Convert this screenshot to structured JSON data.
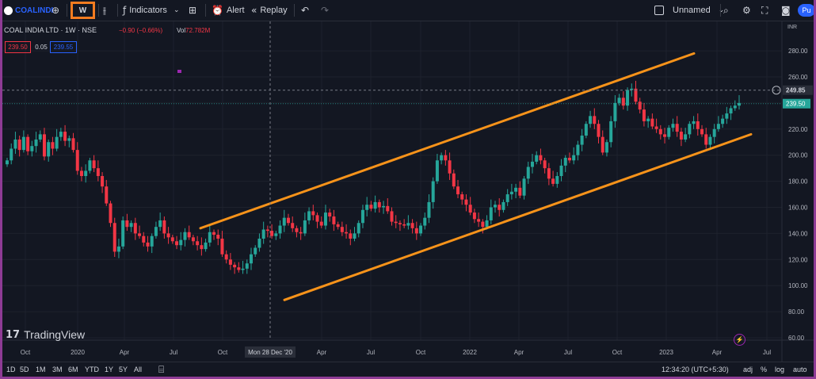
{
  "toolbar": {
    "symbol": "COALINDI",
    "interval": "W",
    "indicators_label": "Indicators",
    "alert_label": "Alert",
    "replay_label": "Replay",
    "layout_name": "Unnamed",
    "user_initials": "Pu",
    "icons": [
      "symbol-logo",
      "add-symbol",
      "bar-style",
      "indicators",
      "templates",
      "alert",
      "replay",
      "undo",
      "redo",
      "layout-checkbox",
      "search",
      "settings",
      "fullscreen",
      "snapshot"
    ]
  },
  "legend": {
    "title": "COAL INDIA LTD · 1W · NSE",
    "change": "−0.90 (−0.66%)",
    "vol_label": "Vol",
    "vol_value": "72.782M",
    "bid": "239.50",
    "spread": "0.05",
    "ask": "239.55"
  },
  "price_axis": {
    "currency": "INR",
    "ticks": [
      "280.00",
      "260.00",
      "240.00",
      "220.00",
      "200.00",
      "180.00",
      "160.00",
      "140.00",
      "120.00",
      "100.00",
      "80.00",
      "60.00"
    ],
    "crosshair_price": "249.85",
    "last_price": "239.50"
  },
  "time_axis": {
    "ticks": [
      "Oct",
      "2020",
      "Apr",
      "Jul",
      "Oct",
      "Apr",
      "Jul",
      "Oct",
      "2022",
      "Apr",
      "Jul",
      "Oct",
      "2023",
      "Apr",
      "Jul"
    ],
    "crosshair_date": "Mon 28 Dec '20"
  },
  "branding": "TradingView",
  "colors": {
    "up": "#26a69a",
    "down": "#f23645",
    "channel": "#f7931a",
    "background": "#131722",
    "frame": "#8e3b95",
    "highlight": "#f47c20"
  },
  "bottom": {
    "ranges": [
      "1D",
      "5D",
      "1M",
      "3M",
      "6M",
      "YTD",
      "1Y",
      "5Y",
      "All"
    ],
    "time": "12:34:20 (UTC+5:30)",
    "adj": "adj",
    "percent": "%",
    "log": "log",
    "auto": "auto"
  },
  "chart_data": {
    "type": "candlestick",
    "symbol": "COAL INDIA LTD",
    "interval": "1W",
    "y_range": [
      60,
      290
    ],
    "series": [
      {
        "name": "price",
        "closes": [
          196,
          205,
          212,
          204,
          214,
          203,
          207,
          212,
          216,
          199,
          210,
          205,
          214,
          218,
          211,
          213,
          204,
          188,
          184,
          188,
          196,
          190,
          184,
          176,
          163,
          148,
          126,
          130,
          150,
          145,
          148,
          140,
          138,
          133,
          130,
          138,
          145,
          150,
          140,
          137,
          134,
          131,
          135,
          141,
          137,
          134,
          131,
          128,
          133,
          141,
          139,
          136,
          124,
          120,
          116,
          114,
          112,
          113,
          117,
          124,
          129,
          136,
          143,
          142,
          138,
          140,
          146,
          152,
          148,
          144,
          141,
          140,
          150,
          157,
          154,
          149,
          146,
          156,
          153,
          147,
          145,
          141,
          140,
          136,
          140,
          148,
          158,
          162,
          159,
          164,
          160,
          161,
          157,
          149,
          148,
          147,
          146,
          148,
          144,
          140,
          146,
          152,
          164,
          180,
          196,
          200,
          196,
          186,
          176,
          170,
          166,
          162,
          156,
          151,
          149,
          145,
          150,
          160,
          162,
          158,
          164,
          170,
          172,
          175,
          169,
          182,
          191,
          195,
          200,
          196,
          190,
          182,
          178,
          184,
          192,
          198,
          196,
          200,
          208,
          215,
          224,
          230,
          224,
          214,
          202,
          210,
          226,
          240,
          244,
          238,
          250,
          251,
          241,
          235,
          226,
          228,
          222,
          220,
          216,
          214,
          221,
          224,
          218,
          212,
          216,
          224,
          226,
          220,
          216,
          208,
          214,
          220,
          224,
          228,
          232,
          236,
          238,
          240
        ]
      },
      {
        "name": "channel-upper",
        "points": [
          [
            250,
            144
          ],
          [
            873,
            278
          ]
        ]
      },
      {
        "name": "channel-lower",
        "points": [
          [
            356,
            89
          ],
          [
            945,
            216
          ]
        ]
      }
    ]
  }
}
